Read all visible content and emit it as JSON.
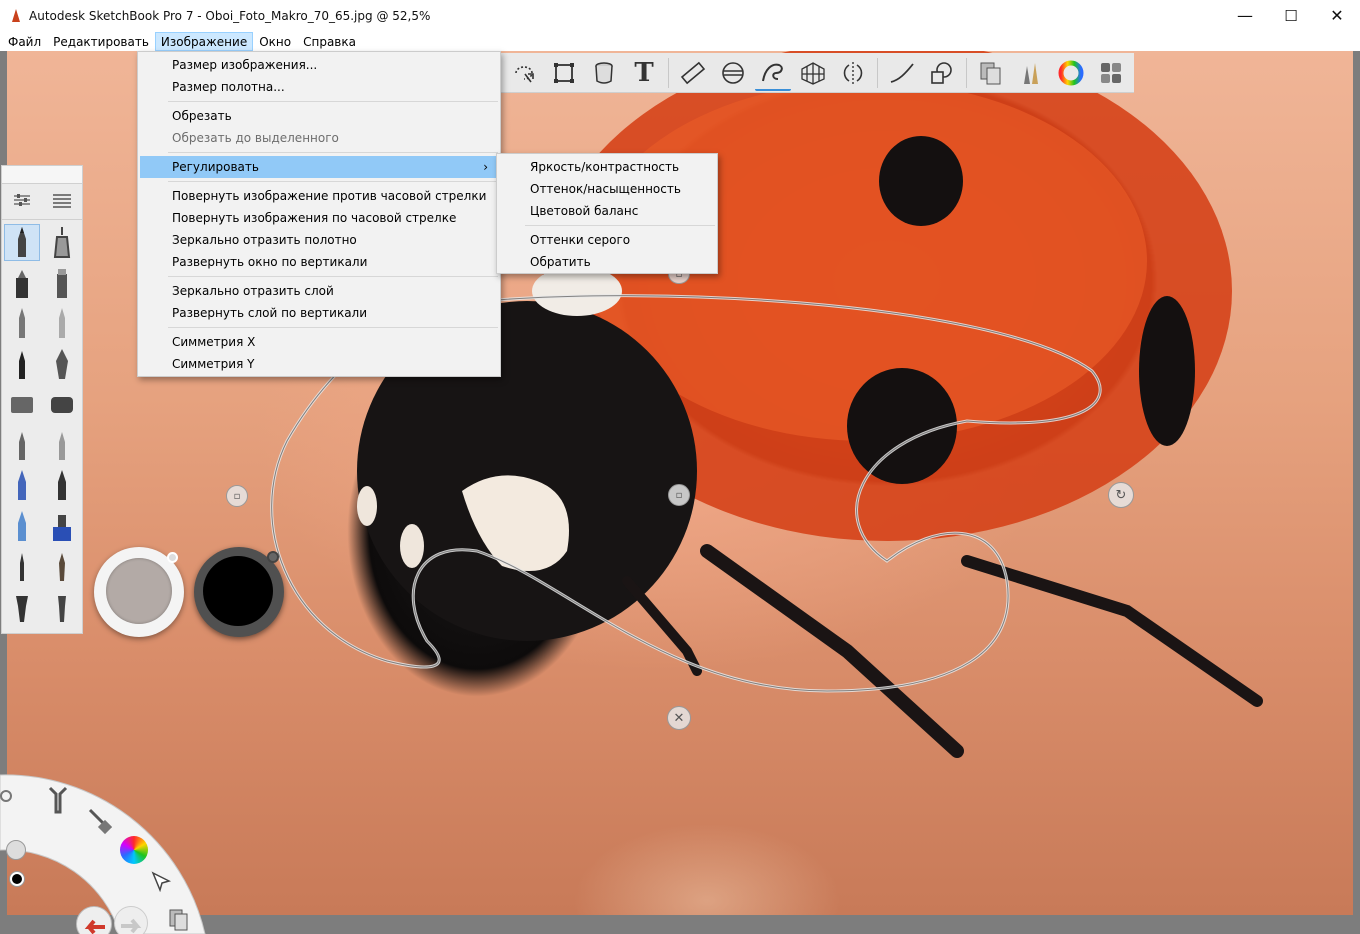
{
  "window": {
    "title": "Autodesk SketchBook Pro 7 - Oboi_Foto_Makro_70_65.jpg @ 52,5%",
    "minimize": "—",
    "maximize": "☐",
    "close": "✕"
  },
  "menubar": {
    "items": [
      {
        "label": "Файл"
      },
      {
        "label": "Редактировать"
      },
      {
        "label": "Изображение",
        "active": true
      },
      {
        "label": "Окно"
      },
      {
        "label": "Справка"
      }
    ]
  },
  "image_menu": {
    "group1": [
      "Размер изображения...",
      "Размер полотна..."
    ],
    "group2": [
      "Обрезать",
      "Обрезать до выделенного"
    ],
    "adjust": {
      "label": "Регулировать",
      "arrow": "›"
    },
    "group3": [
      "Повернуть изображение против часовой стрелки",
      "Повернуть изображения по часовой стрелке",
      "Зеркально отразить полотно",
      "Развернуть окно по вертикали"
    ],
    "group4": [
      "Зеркально отразить слой",
      "Развернуть слой по вертикали"
    ],
    "group5": [
      "Симметрия X",
      "Симметрия Y"
    ]
  },
  "adjust_submenu": {
    "group1": [
      "Яркость/контрастность",
      "Оттенок/насыщенность",
      "Цветовой баланс"
    ],
    "group2": [
      "Оттенки серого",
      "Обратить"
    ]
  },
  "toolbar": {
    "text_tool": "T",
    "selected_tool": "curve-ruler"
  },
  "colors": {
    "accent": "#3a8fd8",
    "menu_highlight": "#91c9f7",
    "primary_color": "#000000",
    "secondary_color": "#b3aaa6",
    "undo_red": "#d0392b"
  },
  "handles": {
    "rotate": "↻",
    "close": "✕"
  }
}
